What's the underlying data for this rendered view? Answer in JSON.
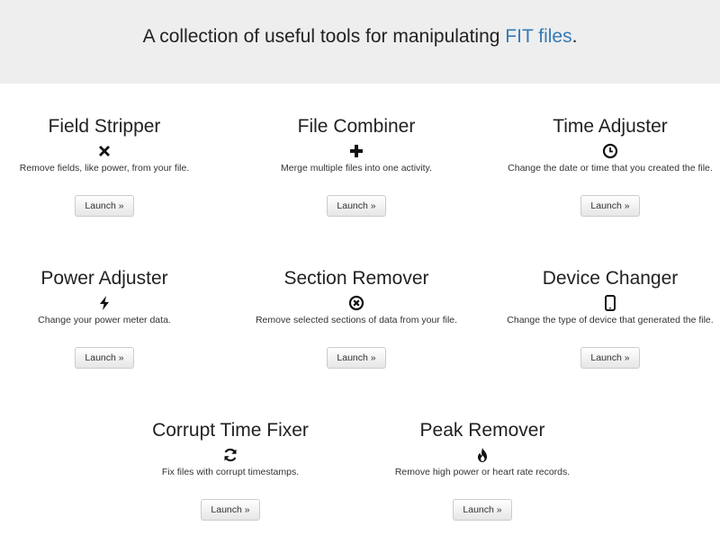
{
  "hero": {
    "text": "A collection of useful tools for manipulating ",
    "link_text": "FIT files",
    "suffix": "."
  },
  "launch_label": "Launch »",
  "tools": [
    {
      "title": "Field Stripper",
      "icon": "remove-x-icon",
      "description": "Remove fields, like power, from your file.",
      "button": "Launch »"
    },
    {
      "title": "File Combiner",
      "icon": "plus-icon",
      "description": "Merge multiple files into one activity.",
      "button": "Launch »"
    },
    {
      "title": "Time Adjuster",
      "icon": "clock-icon",
      "description": "Change the date or time that you created the file.",
      "button": "Launch »"
    },
    {
      "title": "Power Adjuster",
      "icon": "lightning-icon",
      "description": "Change your power meter data.",
      "button": "Launch »"
    },
    {
      "title": "Section Remover",
      "icon": "circle-x-icon",
      "description": "Remove selected sections of data from your file.",
      "button": "Launch »"
    },
    {
      "title": "Device Changer",
      "icon": "phone-icon",
      "description": "Change the type of device that generated the file.",
      "button": "Launch »"
    },
    {
      "title": "Corrupt Time Fixer",
      "icon": "refresh-icon",
      "description": "Fix files with corrupt timestamps.",
      "button": "Launch »"
    },
    {
      "title": "Peak Remover",
      "icon": "fire-icon",
      "description": "Remove high power or heart rate records.",
      "button": "Launch »"
    }
  ]
}
